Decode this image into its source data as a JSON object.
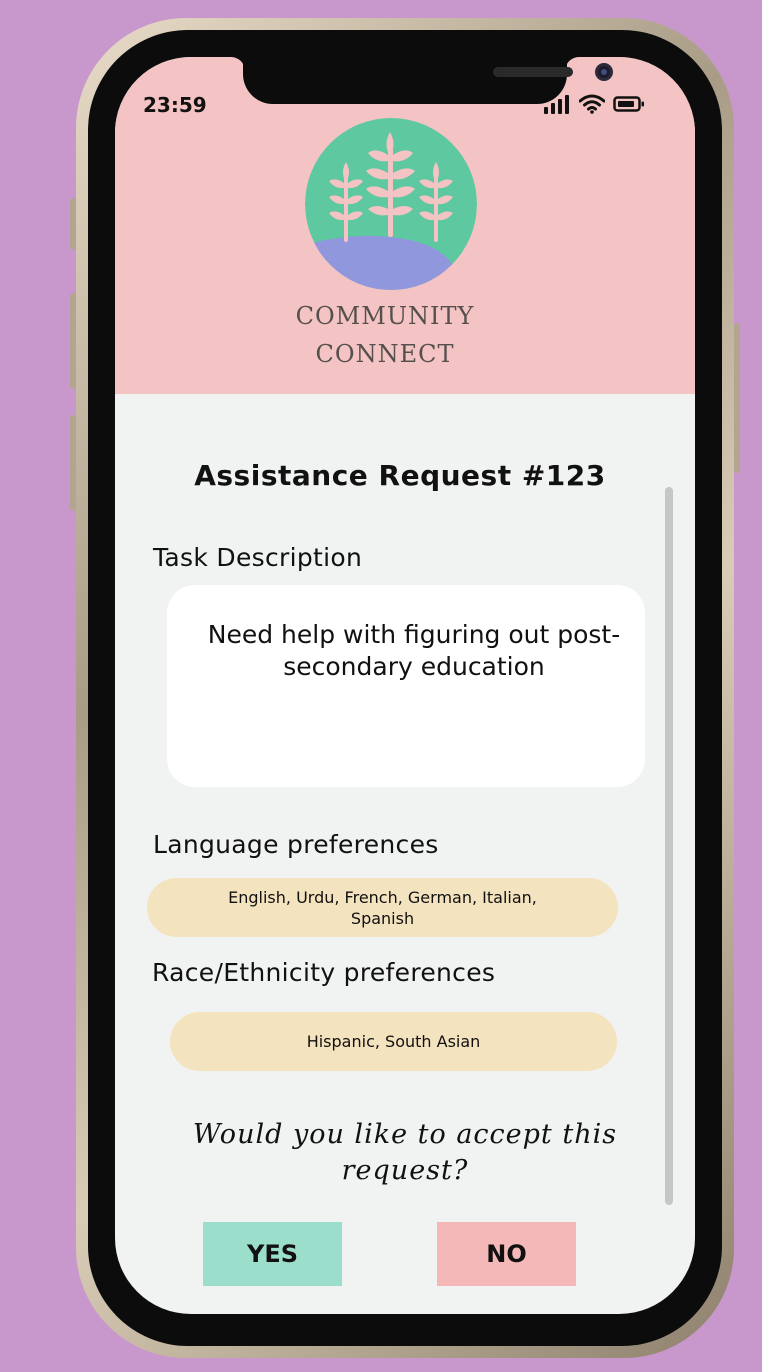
{
  "status_bar": {
    "time": "23:59",
    "icons": [
      "signal-icon",
      "wifi-icon",
      "battery-icon"
    ]
  },
  "brand": {
    "line1": "COMMUNITY",
    "line2": "CONNECT",
    "logo": "wheat-logo-icon"
  },
  "request": {
    "title": "Assistance Request #123",
    "task_label": "Task Description",
    "task_text": "Need help with figuring out post-secondary education",
    "language_label": "Language preferences",
    "languages": "English, Urdu, French, German, Italian, Spanish",
    "race_label": "Race/Ethnicity preferences",
    "race": "Hispanic, South Asian",
    "question": "Would you like to accept this request?"
  },
  "actions": {
    "yes_label": "YES",
    "no_label": "NO"
  },
  "colors": {
    "background": "#c898cd",
    "header": "#f4c3c3",
    "screen": "#f1f3f2",
    "pill": "#f4e3bf",
    "yes": "#9cdecc",
    "no": "#f5b8b8",
    "logo_green": "#5ec8a0",
    "logo_purple": "#9097dc"
  }
}
